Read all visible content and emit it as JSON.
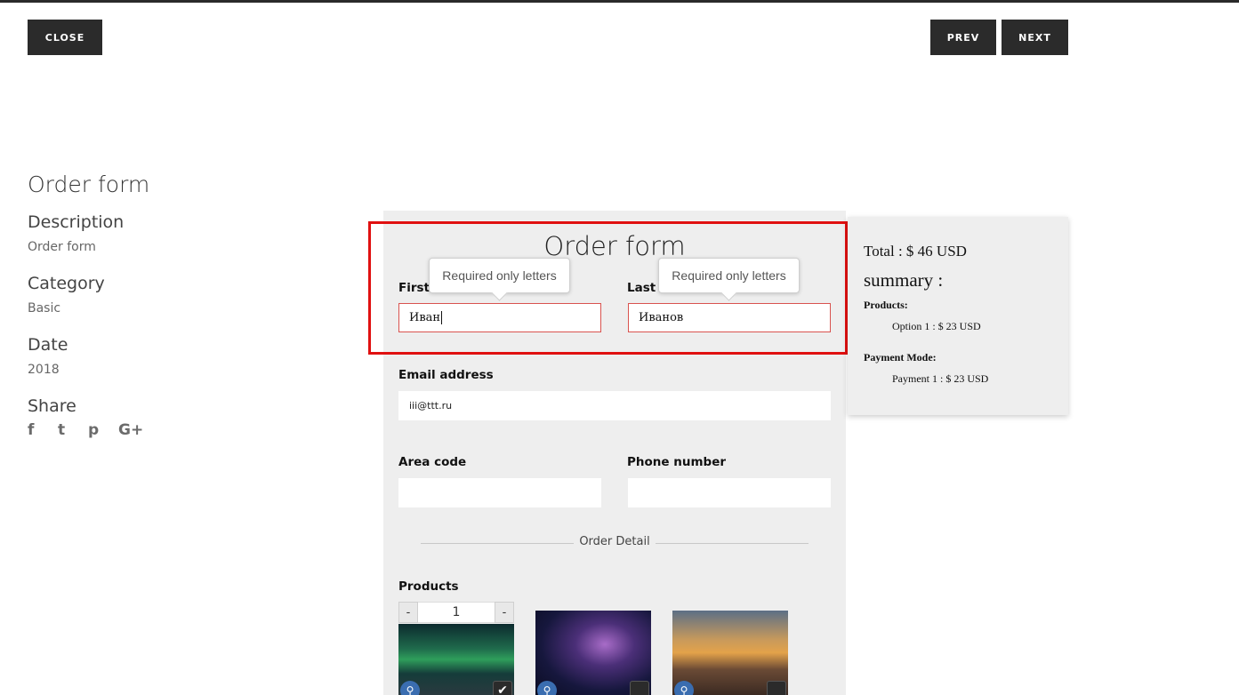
{
  "nav": {
    "close": "CLOSE",
    "prev": "PREV",
    "next": "NEXT"
  },
  "sidebar": {
    "title": "Order form",
    "description_label": "Description",
    "description_value": "Order form",
    "category_label": "Category",
    "category_value": "Basic",
    "date_label": "Date",
    "date_value": "2018",
    "share_label": "Share",
    "share_icons": [
      "facebook-icon",
      "twitter-icon",
      "pinterest-icon",
      "google-plus-icon"
    ],
    "share_glyphs": [
      "f",
      "t",
      "p",
      "G+"
    ]
  },
  "form": {
    "title": "Order form",
    "first_name_label": "First",
    "first_name_value": "Иван",
    "last_name_label": "Last",
    "last_name_value": "Иванов",
    "tooltip_text": "Required only letters",
    "email_label": "Email address",
    "email_value": "iii@ttt.ru",
    "area_code_label": "Area code",
    "area_code_value": "",
    "phone_label": "Phone number",
    "phone_value": "",
    "divider_text": "Order Detail",
    "products_label": "Products",
    "stepper": {
      "minus": "-",
      "value": "1",
      "plus": "-"
    },
    "products": [
      {
        "name": "aurora-image",
        "checked": true
      },
      {
        "name": "milky-way-image",
        "checked": false
      },
      {
        "name": "sunset-mountains-image",
        "checked": false
      }
    ]
  },
  "summary": {
    "total": "Total : $ 46 USD",
    "heading": "summary :",
    "products_label": "Products:",
    "products_item": "Option 1 : $ 23 USD",
    "payment_label": "Payment Mode:",
    "payment_item": "Payment 1 : $ 23 USD"
  },
  "colors": {
    "button_bg": "#2b2b2b",
    "panel_bg": "#eeeeee",
    "highlight": "#e01010",
    "error_border": "#d9534f"
  }
}
